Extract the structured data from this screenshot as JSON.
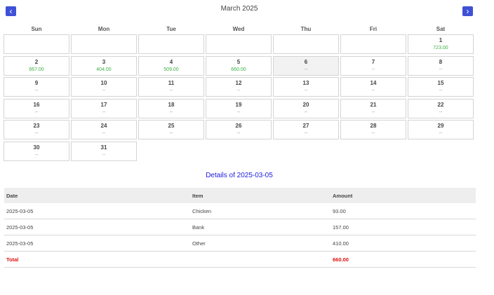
{
  "header": {
    "prev_icon": "‹",
    "next_icon": "›",
    "month_title": "March 2025"
  },
  "calendar": {
    "weekdays": [
      "Sun",
      "Mon",
      "Tue",
      "Wed",
      "Thu",
      "Fri",
      "Sat"
    ],
    "days": [
      {
        "day": "",
        "amount": ""
      },
      {
        "day": "",
        "amount": ""
      },
      {
        "day": "",
        "amount": ""
      },
      {
        "day": "",
        "amount": ""
      },
      {
        "day": "",
        "amount": ""
      },
      {
        "day": "",
        "amount": ""
      },
      {
        "day": "1",
        "amount": "723.00",
        "has_value": true
      },
      {
        "day": "2",
        "amount": "667.00",
        "has_value": true
      },
      {
        "day": "3",
        "amount": "404.00",
        "has_value": true
      },
      {
        "day": "4",
        "amount": "509.00",
        "has_value": true
      },
      {
        "day": "5",
        "amount": "660.00",
        "has_value": true
      },
      {
        "day": "6",
        "amount": "--",
        "selected": true
      },
      {
        "day": "7",
        "amount": "--"
      },
      {
        "day": "8",
        "amount": "--"
      },
      {
        "day": "9",
        "amount": "--"
      },
      {
        "day": "10",
        "amount": "--"
      },
      {
        "day": "11",
        "amount": "--"
      },
      {
        "day": "12",
        "amount": "--"
      },
      {
        "day": "13",
        "amount": "--"
      },
      {
        "day": "14",
        "amount": "--"
      },
      {
        "day": "15",
        "amount": "--"
      },
      {
        "day": "16",
        "amount": "--"
      },
      {
        "day": "17",
        "amount": "--"
      },
      {
        "day": "18",
        "amount": "--"
      },
      {
        "day": "19",
        "amount": "--"
      },
      {
        "day": "20",
        "amount": "--"
      },
      {
        "day": "21",
        "amount": "--"
      },
      {
        "day": "22",
        "amount": "--"
      },
      {
        "day": "23",
        "amount": "--"
      },
      {
        "day": "24",
        "amount": "--"
      },
      {
        "day": "25",
        "amount": "--"
      },
      {
        "day": "26",
        "amount": "--"
      },
      {
        "day": "27",
        "amount": "--"
      },
      {
        "day": "28",
        "amount": "--"
      },
      {
        "day": "29",
        "amount": "--"
      },
      {
        "day": "30",
        "amount": "--"
      },
      {
        "day": "31",
        "amount": "--"
      }
    ]
  },
  "details": {
    "title": "Details of 2025-03-05",
    "columns": {
      "date": "Date",
      "item": "Item",
      "amount": "Amount"
    },
    "rows": [
      {
        "date": "2025-03-05",
        "item": "Chicken",
        "amount": "93.00"
      },
      {
        "date": "2025-03-05",
        "item": "Bank",
        "amount": "157.00"
      },
      {
        "date": "2025-03-05",
        "item": "Other",
        "amount": "410.00"
      }
    ],
    "total": {
      "label": "Total",
      "amount": "660.00"
    }
  },
  "colors": {
    "accent": "#3f51d6",
    "positive_amount": "#3cb043",
    "details_title": "#1a1adf",
    "total": "#dd1111"
  }
}
